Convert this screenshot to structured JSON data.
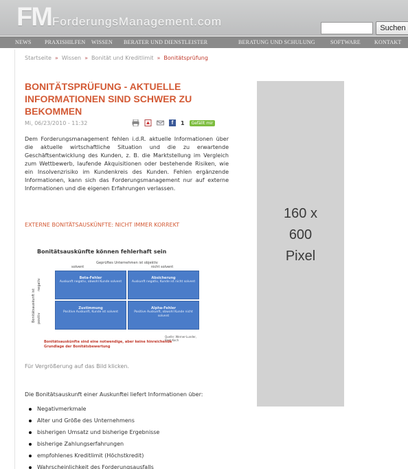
{
  "header": {
    "logo_letters": "FM",
    "site_name": "ForderungsManagement.com",
    "search_placeholder": "",
    "search_button": "Suchen"
  },
  "nav": {
    "items": [
      "News",
      "Praxishilfen",
      "Wissen",
      "Berater und Dienstleister",
      "Beratung und Schulung",
      "Software",
      "Kontakt"
    ]
  },
  "breadcrumb": {
    "items": [
      "Startseite",
      "Wissen",
      "Bonität und Kreditlimit"
    ],
    "separator": "»",
    "current": "Bonitätsprüfung"
  },
  "article": {
    "title": "Bonitätsprüfung - aktuelle Informationen sind schwer zu bekommen",
    "date": "Mi, 06/23/2010 - 11:32",
    "fb_letter": "f",
    "fb_count": "1",
    "like_label": "Gefällt mir",
    "intro": "Dem Forderungsmanagement fehlen i.d.R. aktuelle Informationen über die aktuelle wirtschaftliche Situation und die zu erwartende Geschäftsentwicklung des Kunden, z. B. die Marktstellung im Vergleich zum Wettbewerb, laufende Akquisitionen oder bestehende Risiken, wie ein Insolvenzrisiko im Kundenkreis des Kunden. Fehlen ergänzende Informationen, kann sich das Forderungsmanagement nur auf externe Informationen und die eigenen Erfahrungen verlassen.",
    "subheading": "Externe Bonitätsauskünfte: nicht immer korrekt",
    "enlarge_note": "Für Vergrößerung auf das Bild klicken.",
    "list_intro": "Die Bonitätsauskunft einer Auskunftei liefert Informationen über:",
    "list_items": [
      "Negativmerkmale",
      "Alter und Größe des Unternehmens",
      "bisherigen Umsatz und bisherige Ergebnisse",
      "bisherige Zahlungserfahrungen",
      "empfohlenes Kreditlimit (Höchstkredit)",
      "Wahrscheinlichkeit des Forderungsausfalls"
    ]
  },
  "diagram": {
    "title": "Bonitätsauskünfte können fehlerhaft sein",
    "top_label": "Geprüftes Unternehmen ist objektiv",
    "col_left": "solvent",
    "col_right": "nicht solvent",
    "side_label": "Bonitätsauskunft ist",
    "row_top": "negativ",
    "row_bottom": "positiv",
    "cells": [
      {
        "title": "Beta-Fehler",
        "text": "Auskunft negativ, obwohl Kunde solvent"
      },
      {
        "title": "Absicherung",
        "text": "Auskunft negativ, Kunde ist nicht solvent"
      },
      {
        "title": "Zustimmung",
        "text": "Positive Auskunft, Kunde ist solvent"
      },
      {
        "title": "Alpha-Fehler",
        "text": "Positive Auskunft, obwohl Kunde nicht solvent"
      }
    ],
    "source": "Quelle: Werner-Lunder, Beat Koch",
    "note": "Bonitätsauskünfte sind eine notwendige, aber keine hinreichende Grundlage der Bonitätsbewertung"
  },
  "ad": {
    "line1": "160 x",
    "line2": "600",
    "line3": "Pixel"
  }
}
